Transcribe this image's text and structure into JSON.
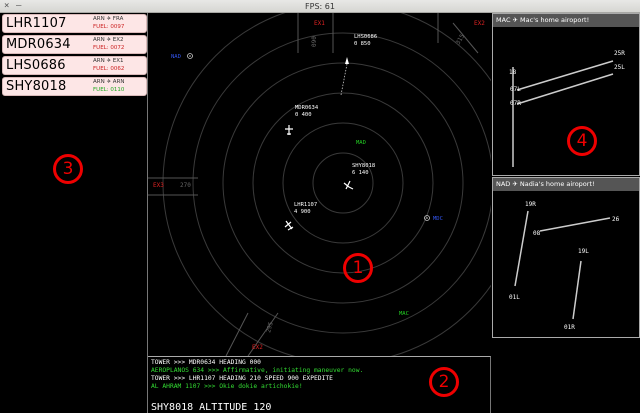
{
  "window": {
    "title": "FPS: 61",
    "close": "×",
    "minimize": "–"
  },
  "strips": [
    {
      "callsign": "LHR1107",
      "route": "ARN ✈ FRA",
      "fuel": "FUEL: 0097",
      "fuel_color": "#cc2222"
    },
    {
      "callsign": "MDR0634",
      "route": "ARN ✈ EX2",
      "fuel": "FUEL: 0072",
      "fuel_color": "#cc2222"
    },
    {
      "callsign": "LHS0686",
      "route": "ARN ✈ EX1",
      "fuel": "FUEL: 0062",
      "fuel_color": "#cc2222"
    },
    {
      "callsign": "SHY8018",
      "route": "ARN ✈ ARN",
      "fuel": "FUEL: 0110",
      "fuel_color": "#22aa22"
    }
  ],
  "radar": {
    "exits": [
      {
        "label": "EX1"
      },
      {
        "label": "EX2"
      },
      {
        "label": "EX3"
      },
      {
        "label": "EX2"
      }
    ],
    "gate_labels": [
      "270",
      "090",
      "295",
      "315"
    ],
    "beacons": [
      {
        "label": "NAD",
        "color": "#3355ee"
      },
      {
        "label": "MAD",
        "color": "#22cc22"
      },
      {
        "label": "MDC",
        "color": "#3355ee"
      },
      {
        "label": "MAC",
        "color": "#22cc22"
      }
    ],
    "aircraft": [
      {
        "callsign": "LHS0686",
        "info": "0 850"
      },
      {
        "callsign": "MDR0634",
        "info": "0 400"
      },
      {
        "callsign": "SHY8018",
        "info": "6 140"
      },
      {
        "callsign": "LHR1107",
        "info": "4 900"
      }
    ]
  },
  "console": {
    "lines": [
      {
        "text": "TOWER >>> MDR0634 HEADING 000",
        "color": "#ffffff"
      },
      {
        "text": "AEROPLANOS 634 >>> Affirmative, initiating maneuver now.",
        "color": "#33dd33"
      },
      {
        "text": "TOWER >>> LHR1107 HEADING 210 SPEED 900 EXPEDITE",
        "color": "#ffffff"
      },
      {
        "text": "AL AHRAM 1107 >>> Okie dokie artichokie!",
        "color": "#33dd33"
      }
    ],
    "command": "SHY8018 ALTITUDE 120"
  },
  "airports": [
    {
      "header": "MAC ✈ Mac's home airoport!",
      "runways": [
        "25R",
        "25L",
        "18",
        "07L",
        "07R",
        "00"
      ]
    },
    {
      "header": "NAD ✈ Nadia's home airoport!",
      "runways": [
        "19R",
        "26",
        "08",
        "19L",
        "01L",
        "01R"
      ]
    }
  ],
  "badges": [
    "1",
    "2",
    "3",
    "4"
  ],
  "colors": {
    "radar_ring": "#3a3a3a",
    "exit": "#dd2222",
    "panel_header": "#555555"
  }
}
